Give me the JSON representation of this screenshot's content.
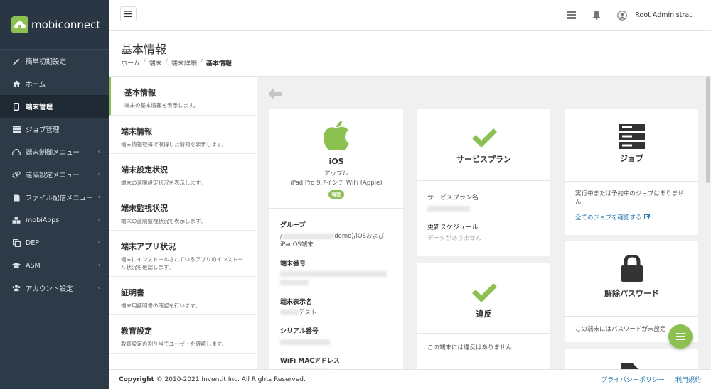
{
  "brand": {
    "name": "mobiconnect",
    "accent": "#8cc152"
  },
  "sidebar": {
    "items": [
      {
        "label": "簡単初期設定",
        "icon": "wand-icon",
        "chevron": false
      },
      {
        "label": "ホーム",
        "icon": "home-icon",
        "chevron": false
      },
      {
        "label": "端末管理",
        "icon": "tablet-icon",
        "chevron": false
      },
      {
        "label": "ジョブ管理",
        "icon": "job-icon",
        "chevron": false
      },
      {
        "label": "端末制御メニュー",
        "icon": "cloud-icon",
        "chevron": true
      },
      {
        "label": "遠隔設定メニュー",
        "icon": "cogs-icon",
        "chevron": true
      },
      {
        "label": "ファイル配信メニュー",
        "icon": "file-icon",
        "chevron": true
      },
      {
        "label": "mobiApps",
        "icon": "cubes-icon",
        "chevron": true
      },
      {
        "label": "DEP",
        "icon": "copy-icon",
        "chevron": true
      },
      {
        "label": "ASM",
        "icon": "graduation-cap-icon",
        "chevron": true
      },
      {
        "label": "アカウント設定",
        "icon": "users-icon",
        "chevron": true
      }
    ]
  },
  "topbar": {
    "user_name": "Root Administrat..."
  },
  "page": {
    "title": "基本情報",
    "breadcrumb": [
      "ホーム",
      "端末",
      "端末詳細",
      "基本情報"
    ]
  },
  "leftlist": [
    {
      "title": "基本情報",
      "desc": "端末の基本情報を表示します。"
    },
    {
      "title": "端末情報",
      "desc": "端末情報取得で取得した情報を表示します。"
    },
    {
      "title": "端末設定状況",
      "desc": "端末の遠隔設定状況を表示します。"
    },
    {
      "title": "端末監視状況",
      "desc": "端末の遠隔監視状況を表示します。"
    },
    {
      "title": "端末アプリ状況",
      "desc": "端末にインストールされているアプリのインストール状況を確認します。"
    },
    {
      "title": "証明書",
      "desc": "端末用証明書の確認を行います。"
    },
    {
      "title": "教育設定",
      "desc": "教育設定の割り当てユーザーを確認します。"
    }
  ],
  "device_card": {
    "os": "iOS",
    "maker": "アップル",
    "model": "iPad Pro 9.7インチ WiFi (Apple)",
    "status_badge": "有効",
    "fields": [
      {
        "label": "グループ",
        "value_prefix": "/",
        "value_suffix": "(demo)/iOSおよびiPadOS端末"
      },
      {
        "label": "端末番号"
      },
      {
        "label": "端末表示名",
        "value_suffix": "テスト"
      },
      {
        "label": "シリアル番号"
      },
      {
        "label": "WiFi MACアドレス"
      }
    ]
  },
  "service_card": {
    "title": "サービスプラン",
    "plan_label": "サービスプラン名",
    "schedule_label": "更新スケジュール",
    "schedule_value": "データがありません"
  },
  "violation_card": {
    "title": "違反",
    "message": "この端末には違反はありません"
  },
  "job_card": {
    "title": "ジョブ",
    "message": "実行中または予約中のジョブはありません",
    "link": "全てのジョブを確認する"
  },
  "password_card": {
    "title": "解除パスワード",
    "message": "この端末にはパスワードが未設定"
  },
  "footer": {
    "copyright_bold": "Copyright",
    "copyright_rest": "© 2010-2021 Inventit Inc. All Rights Reserved.",
    "privacy": "プライバシーポリシー",
    "terms": "利用規約"
  }
}
